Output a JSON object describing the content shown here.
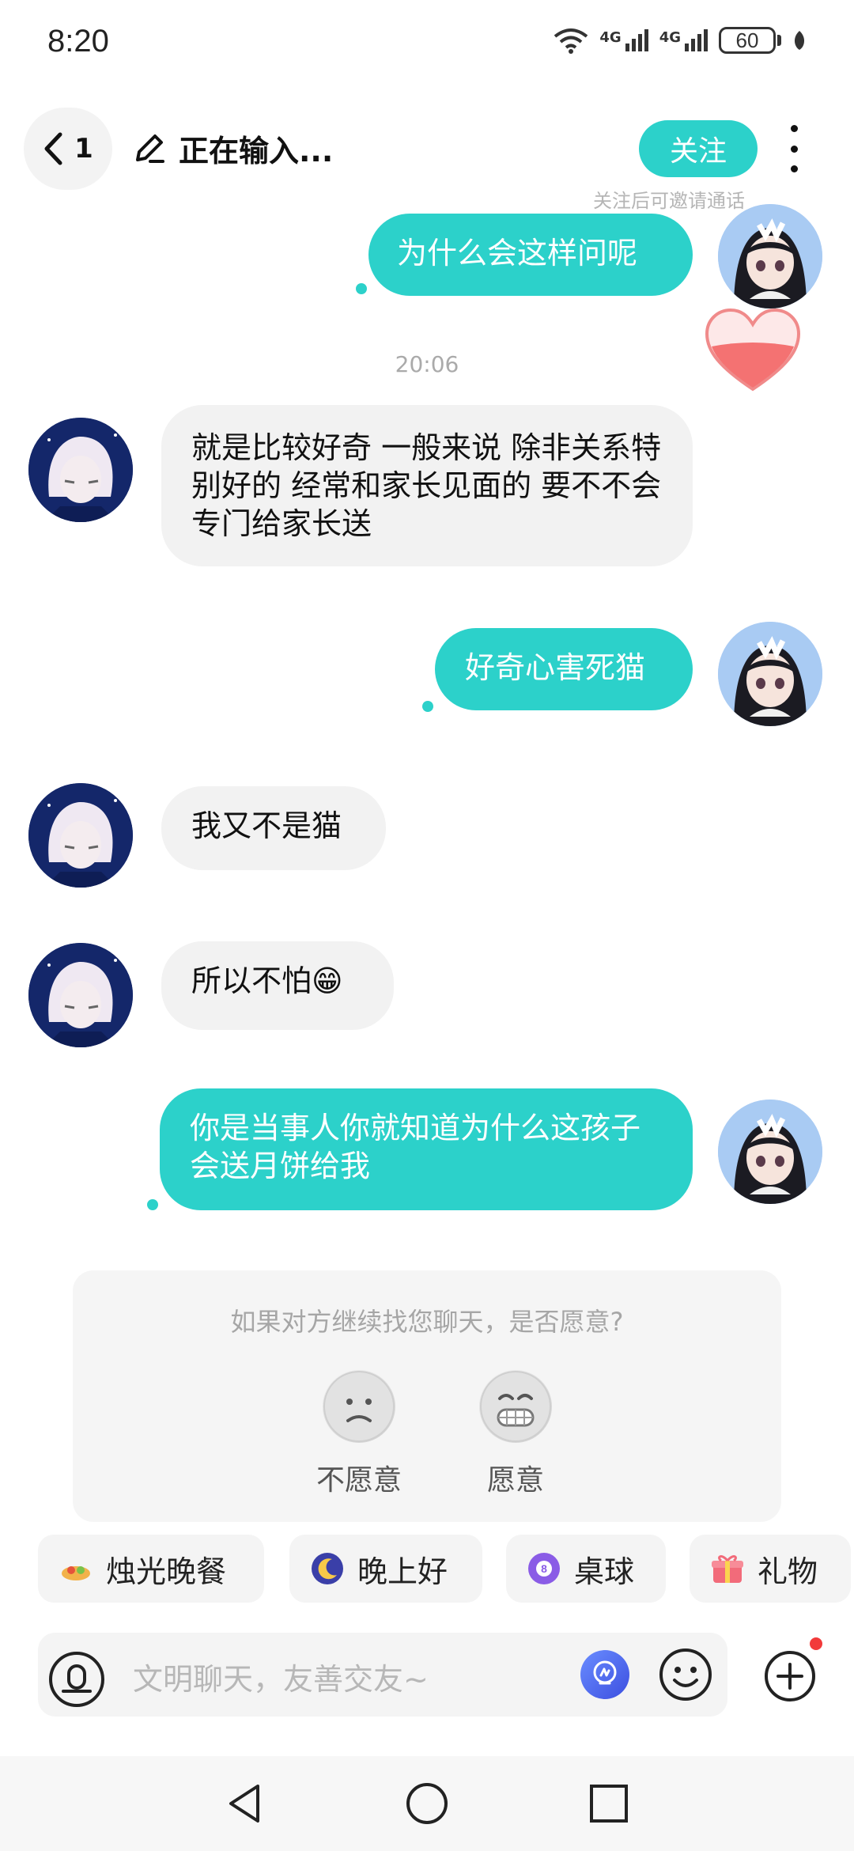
{
  "status_bar": {
    "time": "8:20",
    "network1": "4G",
    "network2": "4G",
    "battery": "60"
  },
  "header": {
    "back_count": "1",
    "title": "正在输入...",
    "follow_label": "关注",
    "follow_hint": "关注后可邀请通话"
  },
  "messages": [
    {
      "side": "out",
      "text": "为什么会这样问呢"
    },
    {
      "side": "in",
      "text": "就是比较好奇  一般来说  除非关系特别好的  经常和家长见面的  要不不会专门给家长送"
    },
    {
      "side": "out",
      "text": "好奇心害死猫"
    },
    {
      "side": "in",
      "text": "我又不是猫"
    },
    {
      "side": "in",
      "text": "所以不怕😁"
    },
    {
      "side": "out",
      "text": "你是当事人你就知道为什么这孩子会送月饼给我"
    }
  ],
  "timestamp": "20:06",
  "survey": {
    "question": "如果对方继续找您聊天，是否愿意?",
    "options": [
      "不愿意",
      "愿意"
    ]
  },
  "quick_chips": [
    {
      "icon": "candle-dinner-icon",
      "label": "烛光晚餐"
    },
    {
      "icon": "moon-icon",
      "label": "晚上好"
    },
    {
      "icon": "billiard-ball-icon",
      "label": "桌球"
    },
    {
      "icon": "gift-icon",
      "label": "礼物"
    }
  ],
  "input": {
    "placeholder": "文明聊天，友善交友~"
  },
  "colors": {
    "accent": "#2cd1ca",
    "bubble_in": "#f2f2f2",
    "notification": "#f23a3a"
  }
}
